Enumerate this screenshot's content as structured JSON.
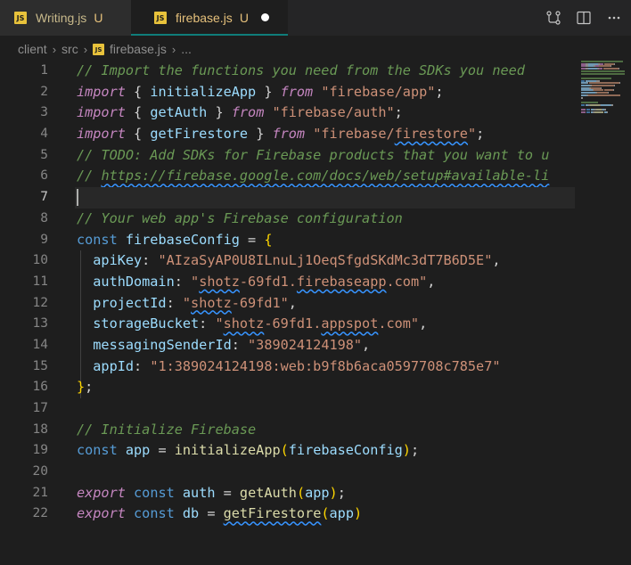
{
  "tabs": [
    {
      "label": "Writing.js",
      "status": "U",
      "badge": "JS",
      "active": false
    },
    {
      "label": "firebase.js",
      "status": "U",
      "badge": "JS",
      "active": true,
      "dirty": true
    }
  ],
  "actions": [
    {
      "icon": "source-control-icon"
    },
    {
      "icon": "split-editor-icon"
    },
    {
      "icon": "more-actions-icon"
    }
  ],
  "breadcrumb": {
    "parts": [
      "client",
      "src"
    ],
    "file_badge": "JS",
    "file": "firebase.js",
    "ellipsis": "..."
  },
  "editor": {
    "current_line": 7,
    "line_numbers": [
      "1",
      "2",
      "3",
      "4",
      "5",
      "6",
      "7",
      "8",
      "9",
      "10",
      "11",
      "12",
      "13",
      "14",
      "15",
      "16",
      "17",
      "18",
      "19",
      "20",
      "21",
      "22"
    ],
    "lines": [
      [
        {
          "t": "// Import the functions you need from the SDKs you need",
          "c": "cm"
        }
      ],
      [
        {
          "t": "import",
          "c": "kw-it"
        },
        {
          "t": " { ",
          "c": "punc"
        },
        {
          "t": "initializeApp",
          "c": "var"
        },
        {
          "t": " } ",
          "c": "punc"
        },
        {
          "t": "from",
          "c": "kw-it"
        },
        {
          "t": " ",
          "c": "punc"
        },
        {
          "t": "\"firebase/app\"",
          "c": "str"
        },
        {
          "t": ";",
          "c": "punc"
        }
      ],
      [
        {
          "t": "import",
          "c": "kw-it"
        },
        {
          "t": " { ",
          "c": "punc"
        },
        {
          "t": "getAuth",
          "c": "var"
        },
        {
          "t": " } ",
          "c": "punc"
        },
        {
          "t": "from",
          "c": "kw-it"
        },
        {
          "t": " ",
          "c": "punc"
        },
        {
          "t": "\"firebase/auth\"",
          "c": "str"
        },
        {
          "t": ";",
          "c": "punc"
        }
      ],
      [
        {
          "t": "import",
          "c": "kw-it"
        },
        {
          "t": " { ",
          "c": "punc"
        },
        {
          "t": "getFirestore",
          "c": "var"
        },
        {
          "t": " } ",
          "c": "punc"
        },
        {
          "t": "from",
          "c": "kw-it"
        },
        {
          "t": " ",
          "c": "punc"
        },
        {
          "t": "\"firebase/",
          "c": "str"
        },
        {
          "t": "firestore",
          "c": "str squig"
        },
        {
          "t": "\"",
          "c": "str"
        },
        {
          "t": ";",
          "c": "punc"
        }
      ],
      [
        {
          "t": "// TODO: Add SDKs for Firebase products that you want to u",
          "c": "cm"
        }
      ],
      [
        {
          "t": "// ",
          "c": "cm"
        },
        {
          "t": "https://firebase.google.com/docs/web/setup#available-li",
          "c": "cm squig-link"
        }
      ],
      [],
      [
        {
          "t": "// Your web app's Firebase configuration",
          "c": "cm"
        }
      ],
      [
        {
          "t": "const",
          "c": "kw"
        },
        {
          "t": " ",
          "c": "punc"
        },
        {
          "t": "firebaseConfig",
          "c": "var"
        },
        {
          "t": " = ",
          "c": "punc"
        },
        {
          "t": "{",
          "c": "br-y"
        }
      ],
      [
        {
          "t": "  apiKey",
          "c": "var"
        },
        {
          "t": ": ",
          "c": "punc"
        },
        {
          "t": "\"AIzaSyAP0U8ILnuLj1OeqSfgdSKdMc3dT7B6D5E\"",
          "c": "str"
        },
        {
          "t": ",",
          "c": "punc"
        }
      ],
      [
        {
          "t": "  authDomain",
          "c": "var"
        },
        {
          "t": ": ",
          "c": "punc"
        },
        {
          "t": "\"",
          "c": "str"
        },
        {
          "t": "shotz",
          "c": "str squig"
        },
        {
          "t": "-69fd1.",
          "c": "str"
        },
        {
          "t": "firebaseapp",
          "c": "str squig"
        },
        {
          "t": ".com\"",
          "c": "str"
        },
        {
          "t": ",",
          "c": "punc"
        }
      ],
      [
        {
          "t": "  projectId",
          "c": "var"
        },
        {
          "t": ": ",
          "c": "punc"
        },
        {
          "t": "\"",
          "c": "str"
        },
        {
          "t": "shotz",
          "c": "str squig"
        },
        {
          "t": "-69fd1\"",
          "c": "str"
        },
        {
          "t": ",",
          "c": "punc"
        }
      ],
      [
        {
          "t": "  storageBucket",
          "c": "var"
        },
        {
          "t": ": ",
          "c": "punc"
        },
        {
          "t": "\"",
          "c": "str"
        },
        {
          "t": "shotz",
          "c": "str squig"
        },
        {
          "t": "-69fd1.",
          "c": "str"
        },
        {
          "t": "appspot",
          "c": "str squig"
        },
        {
          "t": ".com\"",
          "c": "str"
        },
        {
          "t": ",",
          "c": "punc"
        }
      ],
      [
        {
          "t": "  messagingSenderId",
          "c": "var"
        },
        {
          "t": ": ",
          "c": "punc"
        },
        {
          "t": "\"389024124198\"",
          "c": "str"
        },
        {
          "t": ",",
          "c": "punc"
        }
      ],
      [
        {
          "t": "  appId",
          "c": "var"
        },
        {
          "t": ": ",
          "c": "punc"
        },
        {
          "t": "\"1:389024124198:web:b9f8b6aca0597708c785e7\"",
          "c": "str"
        }
      ],
      [
        {
          "t": "}",
          "c": "br-y"
        },
        {
          "t": ";",
          "c": "punc"
        }
      ],
      [],
      [
        {
          "t": "// Initialize Firebase",
          "c": "cm"
        }
      ],
      [
        {
          "t": "const",
          "c": "kw"
        },
        {
          "t": " ",
          "c": "punc"
        },
        {
          "t": "app",
          "c": "var"
        },
        {
          "t": " = ",
          "c": "punc"
        },
        {
          "t": "initializeApp",
          "c": "fn"
        },
        {
          "t": "(",
          "c": "br-y"
        },
        {
          "t": "firebaseConfig",
          "c": "var"
        },
        {
          "t": ")",
          "c": "br-y"
        },
        {
          "t": ";",
          "c": "punc"
        }
      ],
      [],
      [
        {
          "t": "export",
          "c": "kw-it"
        },
        {
          "t": " ",
          "c": "punc"
        },
        {
          "t": "const",
          "c": "kw"
        },
        {
          "t": " ",
          "c": "punc"
        },
        {
          "t": "auth",
          "c": "var"
        },
        {
          "t": " = ",
          "c": "punc"
        },
        {
          "t": "getAuth",
          "c": "fn"
        },
        {
          "t": "(",
          "c": "br-y"
        },
        {
          "t": "app",
          "c": "var"
        },
        {
          "t": ")",
          "c": "br-y"
        },
        {
          "t": ";",
          "c": "punc"
        }
      ],
      [
        {
          "t": "export",
          "c": "kw-it"
        },
        {
          "t": " ",
          "c": "punc"
        },
        {
          "t": "const",
          "c": "kw"
        },
        {
          "t": " ",
          "c": "punc"
        },
        {
          "t": "db",
          "c": "var"
        },
        {
          "t": " = ",
          "c": "punc"
        },
        {
          "t": "getFirestore",
          "c": "fn squig"
        },
        {
          "t": "(",
          "c": "br-y"
        },
        {
          "t": "app",
          "c": "var"
        },
        {
          "t": ")",
          "c": "br-y"
        }
      ]
    ]
  },
  "colors": {
    "background": "#1e1e1e",
    "tab_active_accent": "#0f7d7a",
    "js_badge": "#e8c23b",
    "modified": "#e5c07b"
  }
}
